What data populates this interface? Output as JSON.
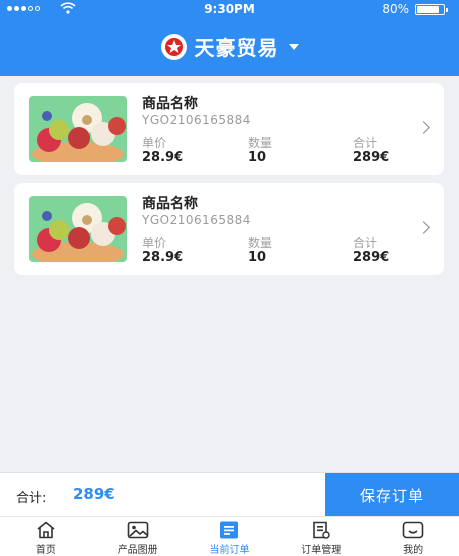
{
  "status_bar": {
    "time": "9:30PM",
    "battery": "80%"
  },
  "header": {
    "title": "天豪贸易"
  },
  "orders": [
    {
      "name": "商品名称",
      "code": "YGO2106165884",
      "unit_price_label": "单价",
      "unit_price": "28.9€",
      "qty_label": "数量",
      "qty": "10",
      "subtotal_label": "合计",
      "subtotal": "289€"
    },
    {
      "name": "商品名称",
      "code": "YGO2106165884",
      "unit_price_label": "单价",
      "unit_price": "28.9€",
      "qty_label": "数量",
      "qty": "10",
      "subtotal_label": "合计",
      "subtotal": "289€"
    }
  ],
  "footer": {
    "total_label": "合计:",
    "total_value": "289€",
    "save_label": "保存订单"
  },
  "tabs": [
    {
      "label": "首页",
      "icon": "home-icon"
    },
    {
      "label": "产品图册",
      "icon": "image-icon"
    },
    {
      "label": "当前订单",
      "icon": "list-icon"
    },
    {
      "label": "订单管理",
      "icon": "document-icon"
    },
    {
      "label": "我的",
      "icon": "profile-icon"
    }
  ],
  "colors": {
    "primary": "#2f8cf2",
    "background": "#eef0f3"
  }
}
